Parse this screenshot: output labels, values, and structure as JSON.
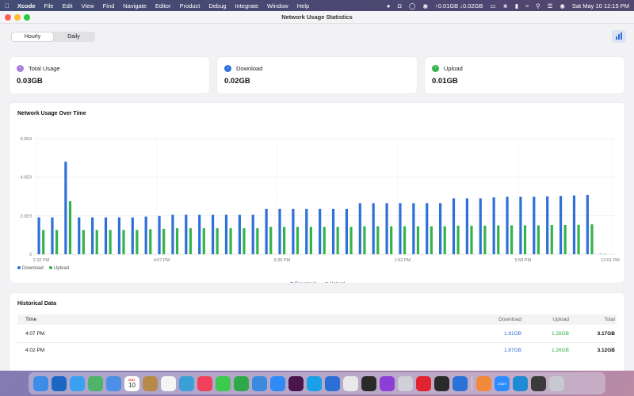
{
  "menubar": {
    "app_name": "Xcode",
    "items": [
      "File",
      "Edit",
      "View",
      "Find",
      "Navigate",
      "Editor",
      "Product",
      "Debug",
      "Integrate",
      "Window",
      "Help"
    ],
    "network_status": "↑0.01GB ↓0.02GB",
    "datetime": "Sat May 10  12:15 PM"
  },
  "window": {
    "title": "Network Usage Statistics"
  },
  "toolbar": {
    "segments": [
      "Hourly",
      "Daily"
    ],
    "selected_segment": "Hourly"
  },
  "summary": [
    {
      "label": "Total Usage",
      "value": "0.03GB",
      "icon": "tray-icon",
      "color": "#a97ddb"
    },
    {
      "label": "Download",
      "value": "0.02GB",
      "icon": "arrow-down-circle-icon",
      "color": "#2f6fd8"
    },
    {
      "label": "Upload",
      "value": "0.01GB",
      "icon": "arrow-up-circle-icon",
      "color": "#34b34a"
    }
  ],
  "chart_data": {
    "type": "bar",
    "title": "Network Usage Over Time",
    "y_tick_labels": [
      "0",
      "2.0E9",
      "4.0E9",
      "6.0E9"
    ],
    "ylim": [
      0,
      6000000000
    ],
    "x_tick_labels": [
      "2:32 PM",
      "4:07 PM",
      "9:36 PM",
      "1:52 PM",
      "5:58 PM",
      "12:01 PM"
    ],
    "series": [
      {
        "name": "Download",
        "color": "#2f6fd8",
        "values": [
          1910000000.0,
          1910000000.0,
          4800000000.0,
          1910000000.0,
          1910000000.0,
          1910000000.0,
          1910000000.0,
          1910000000.0,
          1950000000.0,
          1980000000.0,
          2050000000.0,
          2050000000.0,
          2050000000.0,
          2050000000.0,
          2050000000.0,
          2050000000.0,
          2050000000.0,
          2350000000.0,
          2350000000.0,
          2350000000.0,
          2350000000.0,
          2350000000.0,
          2350000000.0,
          2350000000.0,
          2650000000.0,
          2650000000.0,
          2650000000.0,
          2650000000.0,
          2650000000.0,
          2650000000.0,
          2650000000.0,
          2900000000.0,
          2900000000.0,
          2900000000.0,
          2950000000.0,
          2980000000.0,
          2980000000.0,
          2980000000.0,
          3000000000.0,
          3020000000.0,
          3050000000.0,
          3080000000.0,
          20000000.0
        ]
      },
      {
        "name": "Upload",
        "color": "#34b34a",
        "values": [
          1260000000.0,
          1260000000.0,
          2750000000.0,
          1260000000.0,
          1260000000.0,
          1260000000.0,
          1260000000.0,
          1260000000.0,
          1300000000.0,
          1320000000.0,
          1350000000.0,
          1350000000.0,
          1350000000.0,
          1350000000.0,
          1350000000.0,
          1350000000.0,
          1350000000.0,
          1420000000.0,
          1420000000.0,
          1420000000.0,
          1420000000.0,
          1420000000.0,
          1420000000.0,
          1420000000.0,
          1450000000.0,
          1450000000.0,
          1450000000.0,
          1450000000.0,
          1450000000.0,
          1450000000.0,
          1450000000.0,
          1480000000.0,
          1480000000.0,
          1480000000.0,
          1500000000.0,
          1500000000.0,
          1500000000.0,
          1500000000.0,
          1520000000.0,
          1520000000.0,
          1530000000.0,
          1550000000.0,
          10000000.0
        ]
      }
    ],
    "legend_top": [
      "Download",
      "Upload"
    ],
    "legend_bottom": [
      "Download",
      "Upload"
    ],
    "grid": true,
    "legend_placement": "bottom"
  },
  "history": {
    "title": "Historical Data",
    "columns": {
      "time": "Time",
      "download": "Download",
      "upload": "Upload",
      "total": "Total"
    },
    "rows": [
      {
        "time": "4:07 PM",
        "download": "1.91GB",
        "upload": "1.26GB",
        "total": "3.17GB"
      },
      {
        "time": "4:02 PM",
        "download": "1.87GB",
        "upload": "1.26GB",
        "total": "3.12GB"
      }
    ]
  },
  "dock": {
    "apps": [
      {
        "icon": "finder-icon",
        "color": "#3d8ce8"
      },
      {
        "icon": "outlook-icon",
        "color": "#1a66c2"
      },
      {
        "icon": "safari-icon",
        "color": "#3aa0f0"
      },
      {
        "icon": "maps-icon",
        "color": "#4fb36a"
      },
      {
        "icon": "mail-icon",
        "color": "#4b8fe6"
      },
      {
        "icon": "calendar-icon",
        "color": "#ffffff"
      },
      {
        "icon": "notes-icon",
        "color": "#b88a4a"
      },
      {
        "icon": "reminders-icon",
        "color": "#f5f5f5"
      },
      {
        "icon": "freeform-icon",
        "color": "#3ba0d8"
      },
      {
        "icon": "music-icon",
        "color": "#f2405c"
      },
      {
        "icon": "messages-icon",
        "color": "#3ec94f"
      },
      {
        "icon": "numbers-icon",
        "color": "#2fa84a"
      },
      {
        "icon": "keynote-icon",
        "color": "#3a8ae0"
      },
      {
        "icon": "app-store-icon",
        "color": "#2f8af5"
      },
      {
        "icon": "slack-icon",
        "color": "#4a154b"
      },
      {
        "icon": "skype-icon",
        "color": "#1aa0e8"
      },
      {
        "icon": "location-icon",
        "color": "#2b6fd6"
      },
      {
        "icon": "chrome-icon",
        "color": "#e9e9e9"
      },
      {
        "icon": "activity-monitor-icon",
        "color": "#2a2a2a"
      },
      {
        "icon": "podcasts-icon",
        "color": "#8b3fd6"
      },
      {
        "icon": "launchpad-icon",
        "color": "#d0d0d8"
      },
      {
        "icon": "opera-icon",
        "color": "#e0232e"
      },
      {
        "icon": "pencil-icon",
        "color": "#2a2a2a"
      },
      {
        "icon": "xcode-icon",
        "color": "#2a72d8"
      },
      {
        "icon": "sparkle-icon",
        "color": "#f08a3a"
      },
      {
        "icon": "zoom-icon",
        "color": "#2d8cff"
      },
      {
        "icon": "vscode-icon",
        "color": "#1f8ad6"
      },
      {
        "icon": "simulator-icon",
        "color": "#3a3a3a"
      },
      {
        "icon": "trash-icon",
        "color": "#c8c8d0"
      }
    ],
    "calendar_month": "MAY",
    "calendar_day": "10",
    "zoom_label": "zoom"
  }
}
